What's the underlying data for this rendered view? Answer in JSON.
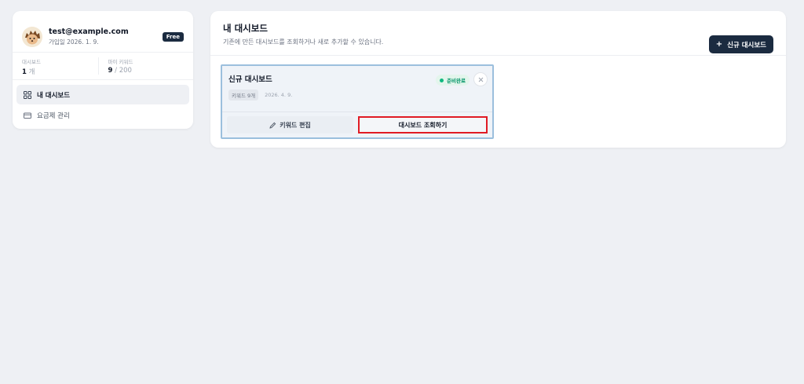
{
  "profile": {
    "email": "test@example.com",
    "joined": "가입일 2026. 1. 9.",
    "plan": "Free"
  },
  "stats": {
    "dashboards_label": "대시보드",
    "dashboards_value": "1",
    "dashboards_unit": " 개",
    "keywords_label": "마이 키워드",
    "keywords_value": "9",
    "keywords_limit": " / 200"
  },
  "nav": {
    "items": [
      {
        "label": "내 대시보드",
        "icon": "grid-icon",
        "active": true
      },
      {
        "label": "요금제 관리",
        "icon": "card-icon",
        "active": false
      }
    ]
  },
  "main": {
    "title": "내 대시보드",
    "subtitle": "기존에 만든 대시보드를 조회하거나 새로 추가할 수 있습니다.",
    "new_button": "신규 대시보드"
  },
  "card": {
    "title": "신규 대시보드",
    "status": "준비완료",
    "keywords_chip": "키워드 9개",
    "date": "2026. 4. 9.",
    "edit_label": "키워드 편집",
    "view_label": "대시보드 조회하기"
  },
  "colors": {
    "accent": "#1b2b40",
    "status_green": "#10b981",
    "highlight_red": "#e01b24",
    "card_border": "#9bbfdd"
  }
}
